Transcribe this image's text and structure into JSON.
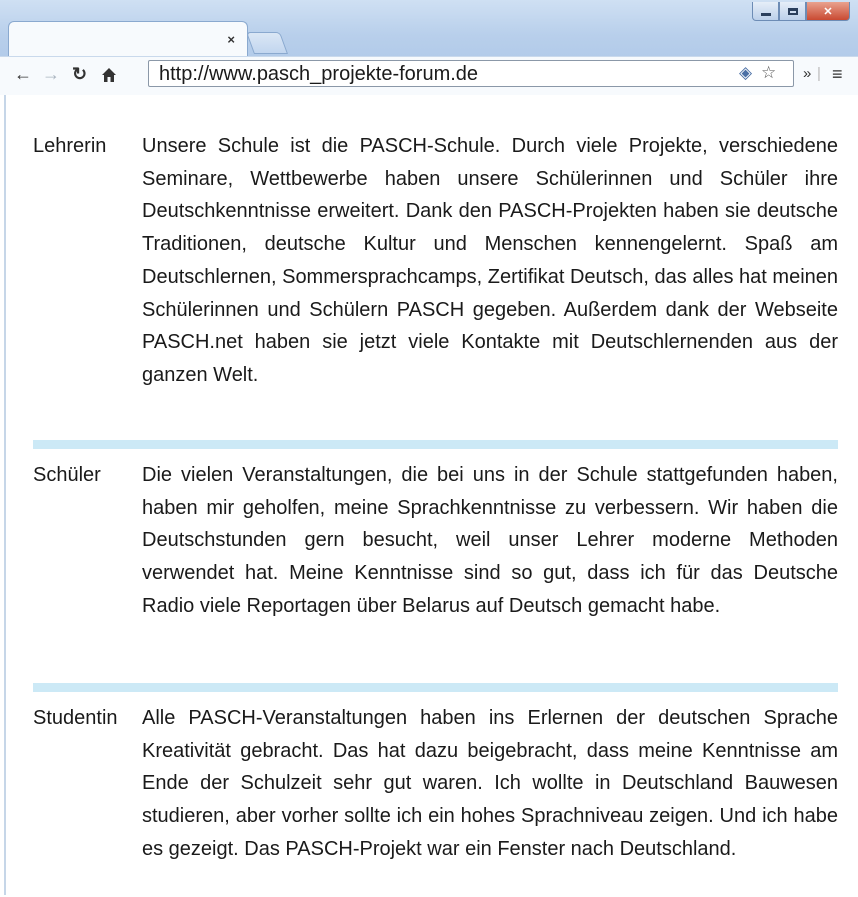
{
  "browser": {
    "tab_close_glyph": "×",
    "url": "http://www.pasch_projekte-forum.de",
    "icons": [
      "back-icon",
      "forward-icon",
      "reload-icon",
      "home-icon",
      "extension-icon",
      "star-icon",
      "more-icon",
      "menu-icon"
    ]
  },
  "entries": [
    {
      "role": "Lehrerin",
      "text": "Unsere Schule ist die PASCH-Schule. Durch viele Projekte, verschiedene Seminare, Wettbewerbe haben unsere Schülerinnen und Schüler ihre Deutschkenntnisse erweitert. Dank den PASCH-Projekten haben sie deutsche Traditionen, deutsche Kultur und Menschen kennengelernt. Spaß am Deutschlernen, Sommersprachcamps, Zertifikat Deutsch, das alles hat meinen Schülerinnen und Schülern PASCH gegeben. Außerdem dank der Webseite PASCH.net haben sie jetzt viele Kontakte mit Deutschlernenden aus der ganzen Welt."
    },
    {
      "role": "Schüler",
      "text": "Die vielen Veranstaltungen, die bei uns in der Schule stattgefunden haben, haben mir geholfen, meine Sprachkenntnisse zu verbessern. Wir haben die Deutschstunden gern besucht, weil unser Lehrer moderne Methoden verwendet hat. Meine Kenntnisse sind so gut, dass ich für das Deutsche Radio viele Reportagen über Belarus auf Deutsch gemacht habe."
    },
    {
      "role": "Studentin",
      "text": "Alle PASCH-Veranstaltungen haben ins Erlernen der deutschen Sprache Kreativität gebracht. Das hat dazu beigebracht, dass meine Kenntnisse am Ende der Schulzeit sehr gut waren. Ich wollte in Deutschland Bauwesen studieren, aber vorher sollte ich ein hohes Sprachniveau zeigen. Und ich habe es gezeigt. Das PASCH-Projekt war ein Fenster nach Deutschland."
    }
  ],
  "colors": {
    "divider": "#cce9f6",
    "chrome": "#b8cfeb",
    "close_button": "#c94a32"
  }
}
